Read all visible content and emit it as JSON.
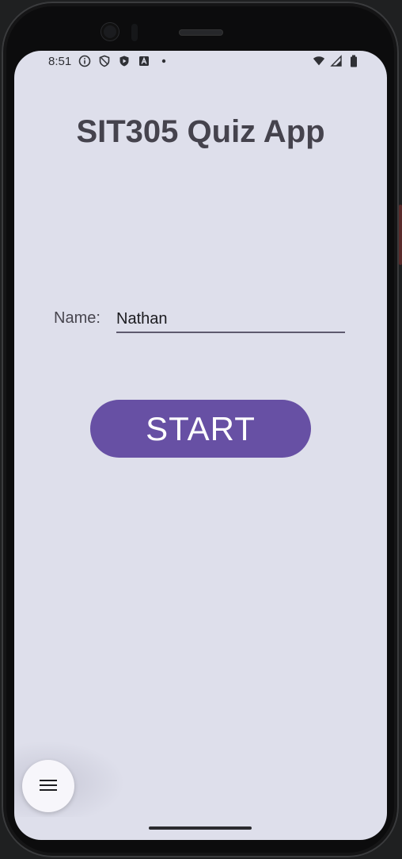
{
  "status_bar": {
    "time": "8:51",
    "left_icons": [
      "info-icon",
      "shield-icon",
      "play-shield-icon",
      "font-a-icon",
      "dot-icon"
    ],
    "right_icons": [
      "wifi-icon",
      "signal-icon",
      "battery-icon"
    ]
  },
  "app": {
    "title": "SIT305 Quiz App",
    "name_label": "Name:",
    "name_value": "Nathan",
    "start_label": "START",
    "accent_color": "#6750a4",
    "background_color": "#dedfeb"
  },
  "fab": {
    "icon": "menu-icon"
  }
}
